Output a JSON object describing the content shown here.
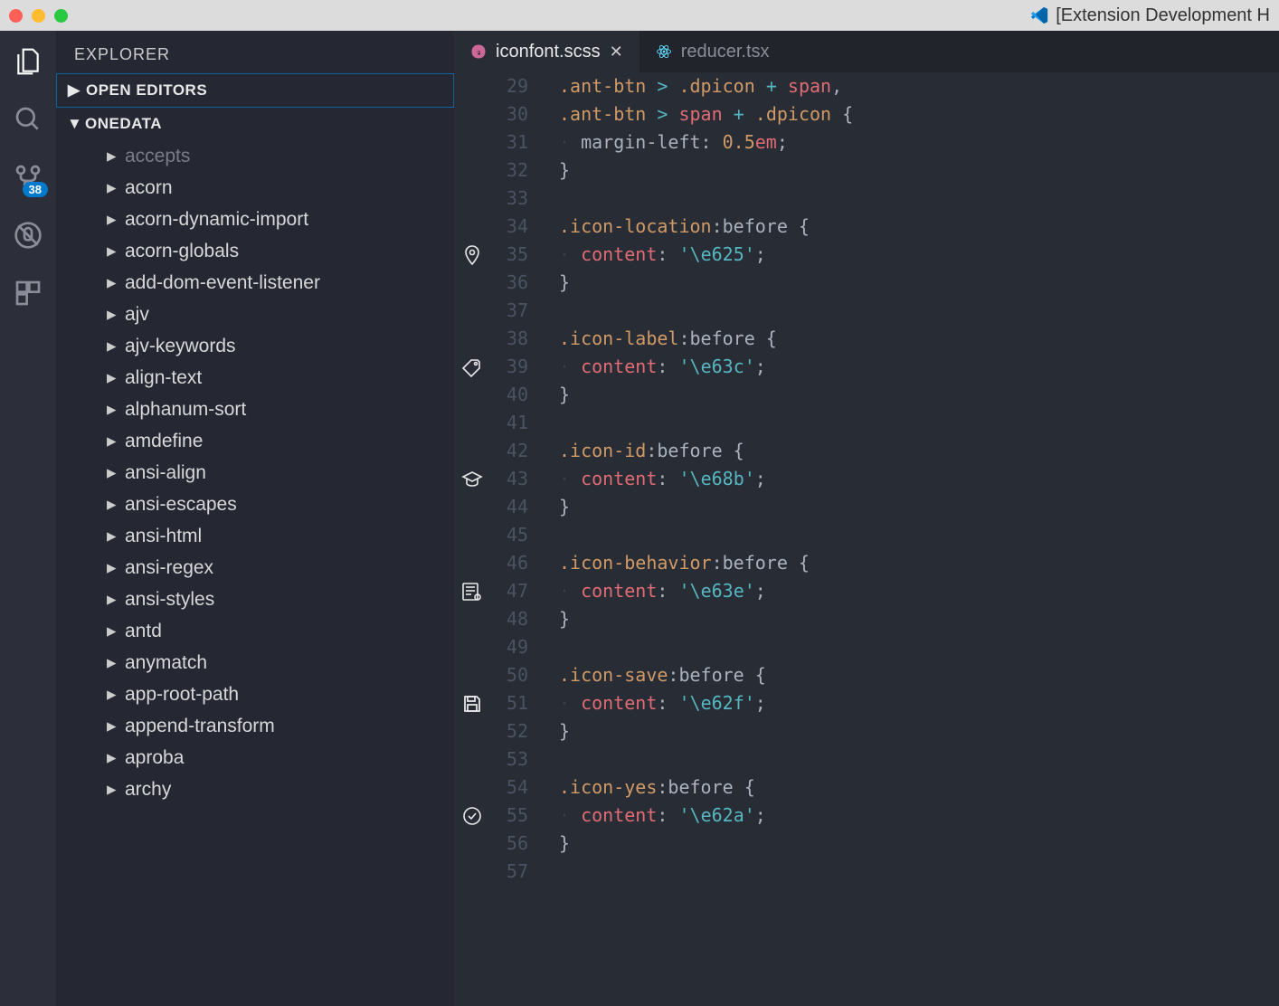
{
  "window": {
    "title": "[Extension Development H"
  },
  "sidebar": {
    "title": "EXPLORER",
    "sections": {
      "openEditors": "OPEN EDITORS",
      "workspace": "ONEDATA"
    },
    "tree": [
      {
        "label": "accepts",
        "dim": true
      },
      {
        "label": "acorn"
      },
      {
        "label": "acorn-dynamic-import"
      },
      {
        "label": "acorn-globals"
      },
      {
        "label": "add-dom-event-listener"
      },
      {
        "label": "ajv"
      },
      {
        "label": "ajv-keywords"
      },
      {
        "label": "align-text"
      },
      {
        "label": "alphanum-sort"
      },
      {
        "label": "amdefine"
      },
      {
        "label": "ansi-align"
      },
      {
        "label": "ansi-escapes"
      },
      {
        "label": "ansi-html"
      },
      {
        "label": "ansi-regex"
      },
      {
        "label": "ansi-styles"
      },
      {
        "label": "antd"
      },
      {
        "label": "anymatch"
      },
      {
        "label": "app-root-path"
      },
      {
        "label": "append-transform"
      },
      {
        "label": "aproba"
      },
      {
        "label": "archy"
      }
    ]
  },
  "activitybar": {
    "scmBadge": "38"
  },
  "tabs": [
    {
      "label": "iconfont.scss",
      "icon": "sass-icon",
      "active": true,
      "closeable": true
    },
    {
      "label": "reducer.tsx",
      "icon": "react-icon",
      "active": false,
      "closeable": false
    }
  ],
  "editor": {
    "startLine": 29,
    "lines": [
      {
        "n": 29,
        "html": "<span class='tok-sel'>.ant-btn</span> <span class='tok-op'>&gt;</span> <span class='tok-sel'>.dpicon</span> <span class='tok-op'>+</span> <span class='tok-tag'>span</span><span class='tok-brace'>,</span>"
      },
      {
        "n": 30,
        "html": "<span class='tok-sel'>.ant-btn</span> <span class='tok-op'>&gt;</span> <span class='tok-tag'>span</span> <span class='tok-op'>+</span> <span class='tok-sel'>.dpicon</span> <span class='tok-brace'>{</span>"
      },
      {
        "n": 31,
        "html": "<span class='indent-guide'>·</span> <span class='tok-prop'>margin-left</span>: <span class='tok-num'>0.5</span><span class='tok-unit'>em</span>;"
      },
      {
        "n": 32,
        "html": "<span class='tok-brace'>}</span>"
      },
      {
        "n": 33,
        "html": ""
      },
      {
        "n": 34,
        "html": "<span class='tok-sel'>.icon-location</span><span class='tok-pseudo'>:before</span> <span class='tok-brace'>{</span>"
      },
      {
        "n": 35,
        "html": "<span class='indent-guide'>·</span> <span class='tok-tag'>content</span>: <span class='tok-str'>'\\e625'</span>;",
        "icon": "pin"
      },
      {
        "n": 36,
        "html": "<span class='tok-brace'>}</span>"
      },
      {
        "n": 37,
        "html": ""
      },
      {
        "n": 38,
        "html": "<span class='tok-sel'>.icon-label</span><span class='tok-pseudo'>:before</span> <span class='tok-brace'>{</span>"
      },
      {
        "n": 39,
        "html": "<span class='indent-guide'>·</span> <span class='tok-tag'>content</span>: <span class='tok-str'>'\\e63c'</span>;",
        "icon": "tag"
      },
      {
        "n": 40,
        "html": "<span class='tok-brace'>}</span>"
      },
      {
        "n": 41,
        "html": ""
      },
      {
        "n": 42,
        "html": "<span class='tok-sel'>.icon-id</span><span class='tok-pseudo'>:before</span> <span class='tok-brace'>{</span>"
      },
      {
        "n": 43,
        "html": "<span class='indent-guide'>·</span> <span class='tok-tag'>content</span>: <span class='tok-str'>'\\e68b'</span>;",
        "icon": "grad"
      },
      {
        "n": 44,
        "html": "<span class='tok-brace'>}</span>"
      },
      {
        "n": 45,
        "html": ""
      },
      {
        "n": 46,
        "html": "<span class='tok-sel'>.icon-behavior</span><span class='tok-pseudo'>:before</span> <span class='tok-brace'>{</span>"
      },
      {
        "n": 47,
        "html": "<span class='indent-guide'>·</span> <span class='tok-tag'>content</span>: <span class='tok-str'>'\\e63e'</span>;",
        "icon": "gearlist"
      },
      {
        "n": 48,
        "html": "<span class='tok-brace'>}</span>"
      },
      {
        "n": 49,
        "html": ""
      },
      {
        "n": 50,
        "html": "<span class='tok-sel'>.icon-save</span><span class='tok-pseudo'>:before</span> <span class='tok-brace'>{</span>"
      },
      {
        "n": 51,
        "html": "<span class='indent-guide'>·</span> <span class='tok-tag'>content</span>: <span class='tok-str'>'\\e62f'</span>;",
        "icon": "save"
      },
      {
        "n": 52,
        "html": "<span class='tok-brace'>}</span>"
      },
      {
        "n": 53,
        "html": ""
      },
      {
        "n": 54,
        "html": "<span class='tok-sel'>.icon-yes</span><span class='tok-pseudo'>:before</span> <span class='tok-brace'>{</span>"
      },
      {
        "n": 55,
        "html": "<span class='indent-guide'>·</span> <span class='tok-tag'>content</span>: <span class='tok-str'>'\\e62a'</span>;",
        "icon": "check"
      },
      {
        "n": 56,
        "html": "<span class='tok-brace'>}</span>"
      },
      {
        "n": 57,
        "html": ""
      }
    ]
  }
}
